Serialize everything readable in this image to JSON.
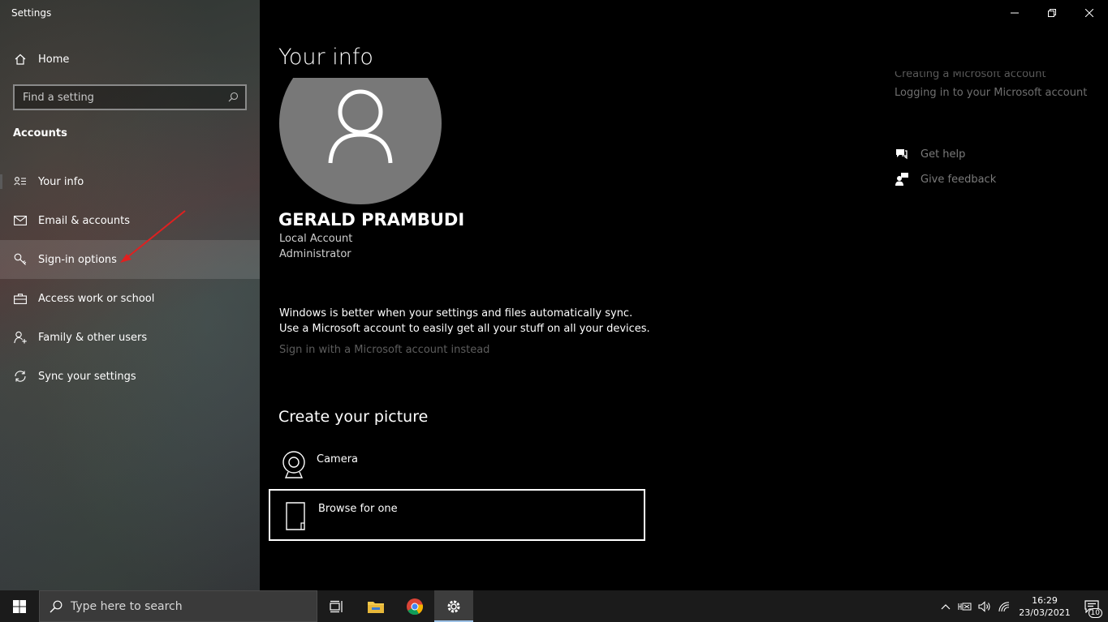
{
  "window": {
    "title": "Settings"
  },
  "sidebar": {
    "home_label": "Home",
    "search_placeholder": "Find a setting",
    "section_title": "Accounts",
    "items": [
      {
        "label": "Your info",
        "icon": "person-card-icon"
      },
      {
        "label": "Email & accounts",
        "icon": "mail-icon"
      },
      {
        "label": "Sign-in options",
        "icon": "key-icon"
      },
      {
        "label": "Access work or school",
        "icon": "briefcase-icon"
      },
      {
        "label": "Family & other users",
        "icon": "person-add-icon"
      },
      {
        "label": "Sync your settings",
        "icon": "sync-icon"
      }
    ]
  },
  "main": {
    "title": "Your info",
    "user_name": "GERALD PRAMBUDI",
    "account_type": "Local Account",
    "account_role": "Administrator",
    "sync_text": "Windows is better when your settings and files automatically sync. Use a Microsoft account to easily get all your stuff on all your devices.",
    "ms_link": "Sign in with a Microsoft account instead",
    "create_title": "Create your picture",
    "options": [
      {
        "label": "Camera",
        "icon": "camera-icon"
      },
      {
        "label": "Browse for one",
        "icon": "file-icon"
      }
    ]
  },
  "related": {
    "links": [
      "Creating a Microsoft account",
      "Logging in to your Microsoft account"
    ],
    "get_help": "Get help",
    "give_feedback": "Give feedback"
  },
  "taskbar": {
    "search_placeholder": "Type here to search",
    "time": "16:29",
    "date": "23/03/2021",
    "notification_count": "10"
  },
  "colors": {
    "accent": "#ffffff",
    "annotation_arrow": "#e02020"
  }
}
